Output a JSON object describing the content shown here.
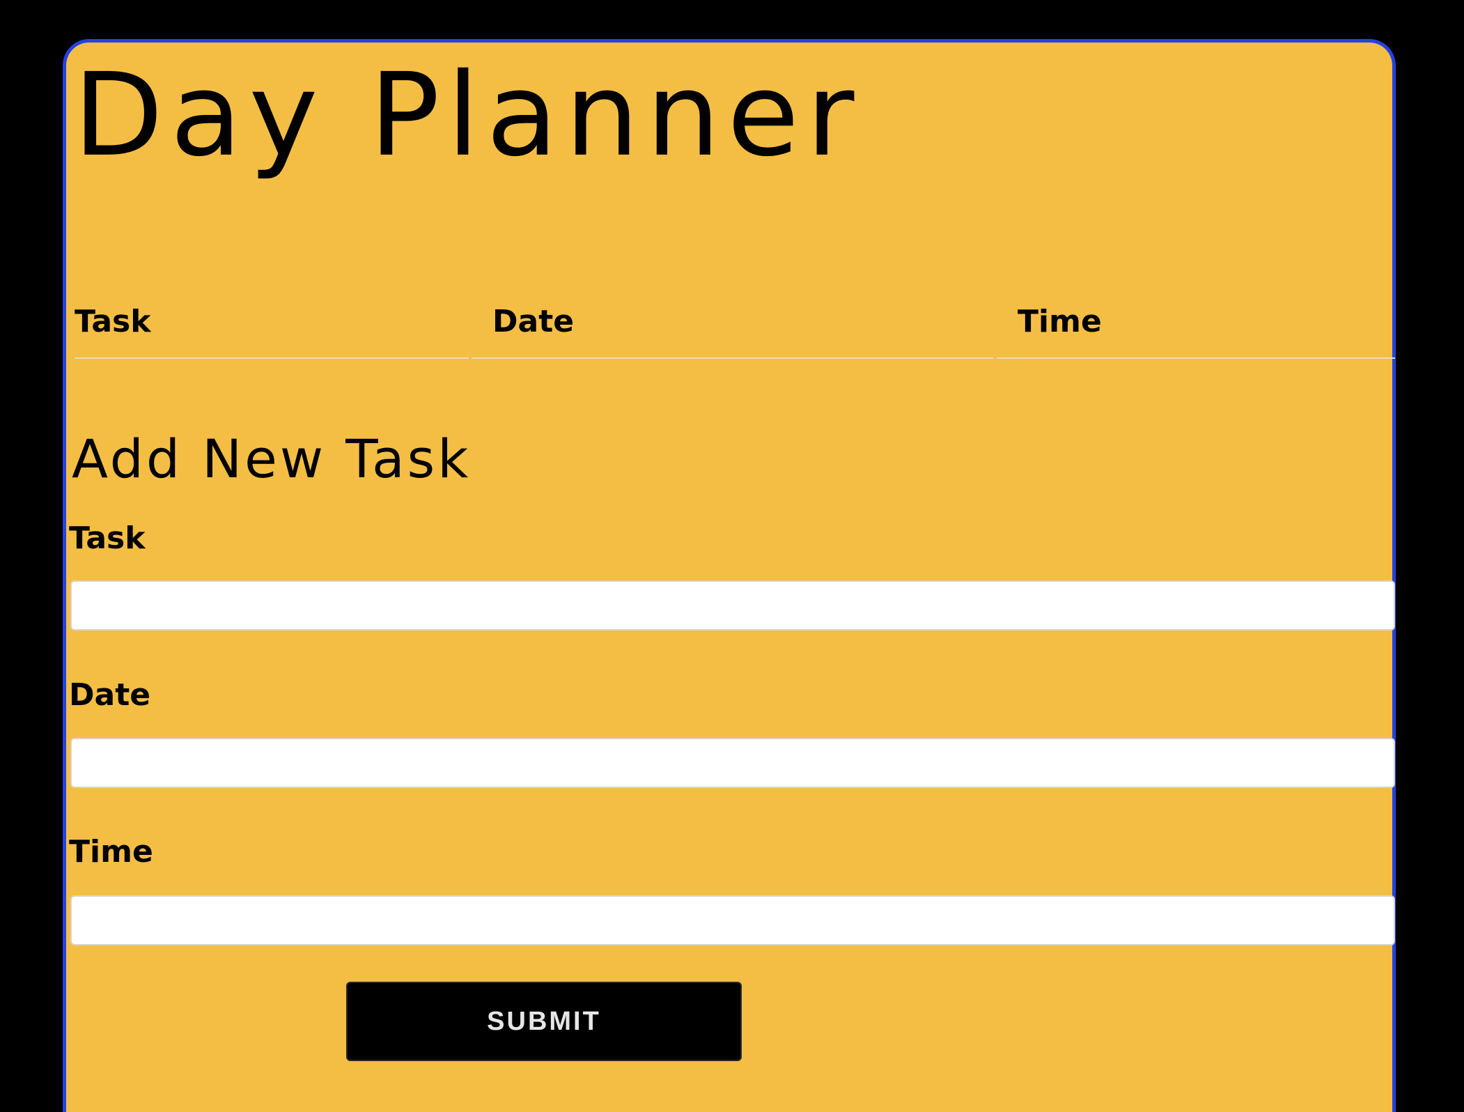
{
  "app": {
    "title": "Day Planner"
  },
  "table": {
    "columns": [
      "Task",
      "Date",
      "Time"
    ],
    "rows": []
  },
  "form": {
    "title": "Add New Task",
    "fields": [
      {
        "label": "Task",
        "value": "",
        "placeholder": ""
      },
      {
        "label": "Date",
        "value": "",
        "placeholder": ""
      },
      {
        "label": "Time",
        "value": "",
        "placeholder": ""
      }
    ],
    "submit_label": "SUBMIT"
  },
  "colors": {
    "page_background": "#000000",
    "card_background": "#f4be45",
    "card_border": "#2342e4",
    "button_background": "#000000",
    "button_text": "#e6e6e6"
  }
}
